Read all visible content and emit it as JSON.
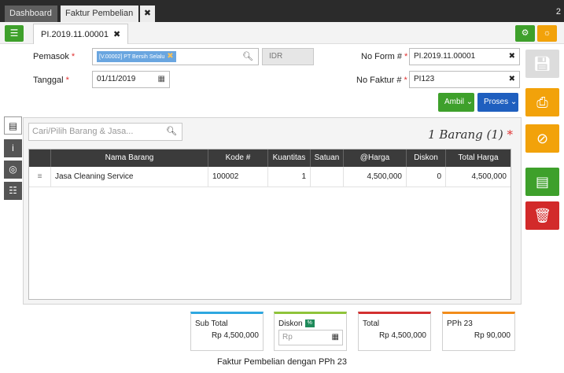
{
  "tabs": {
    "dashboard": "Dashboard",
    "faktur": "Faktur Pembelian",
    "close": "✖",
    "counter": "2"
  },
  "doc_tab": {
    "label": "PI.2019.11.00001",
    "close": "✖"
  },
  "form": {
    "pemasok_label": "Pemasok",
    "pemasok_value": "[V.00002] PT Bersih Selalu",
    "currency": "IDR",
    "tanggal_label": "Tanggal",
    "tanggal_value": "01/11/2019",
    "noform_label": "No Form #",
    "noform_value": "PI.2019.11.00001",
    "nofaktur_label": "No Faktur #",
    "nofaktur_value": "PI123",
    "required_mark": "*"
  },
  "actions": {
    "ambil": "Ambil",
    "proses": "Proses"
  },
  "items": {
    "search_placeholder": "Cari/Pilih Barang & Jasa...",
    "count_text": "1 Barang (1)",
    "count_mark": "*",
    "columns": [
      "Nama Barang",
      "Kode #",
      "Kuantitas",
      "Satuan",
      "@Harga",
      "Diskon",
      "Total Harga"
    ],
    "rows": [
      {
        "nama": "Jasa Cleaning Service",
        "kode": "100002",
        "kuantitas": "1",
        "satuan": "",
        "harga": "4,500,000",
        "diskon": "0",
        "total": "4,500,000"
      }
    ]
  },
  "totals": {
    "subtotal_label": "Sub Total",
    "subtotal_value": "Rp 4,500,000",
    "diskon_label": "Diskon",
    "diskon_badge": "%",
    "diskon_placeholder": "Rp",
    "total_label": "Total",
    "total_value": "Rp 4,500,000",
    "pph_label": "PPh 23",
    "pph_value": "Rp 90,000"
  },
  "caption": "Faktur Pembelian dengan PPh 23",
  "colors": {
    "green": "#3ea02b",
    "blue": "#1f5fbf",
    "orange": "#f2a20a",
    "red": "#d22a2a"
  },
  "icons": [
    "list-icon",
    "gear-icon",
    "bulb-icon",
    "search-icon",
    "calendar-icon",
    "save-icon",
    "print-icon",
    "attach-icon",
    "briefcase-icon",
    "trash-icon",
    "info-icon",
    "coins-icon",
    "checklist-icon",
    "drag-handle-icon"
  ]
}
